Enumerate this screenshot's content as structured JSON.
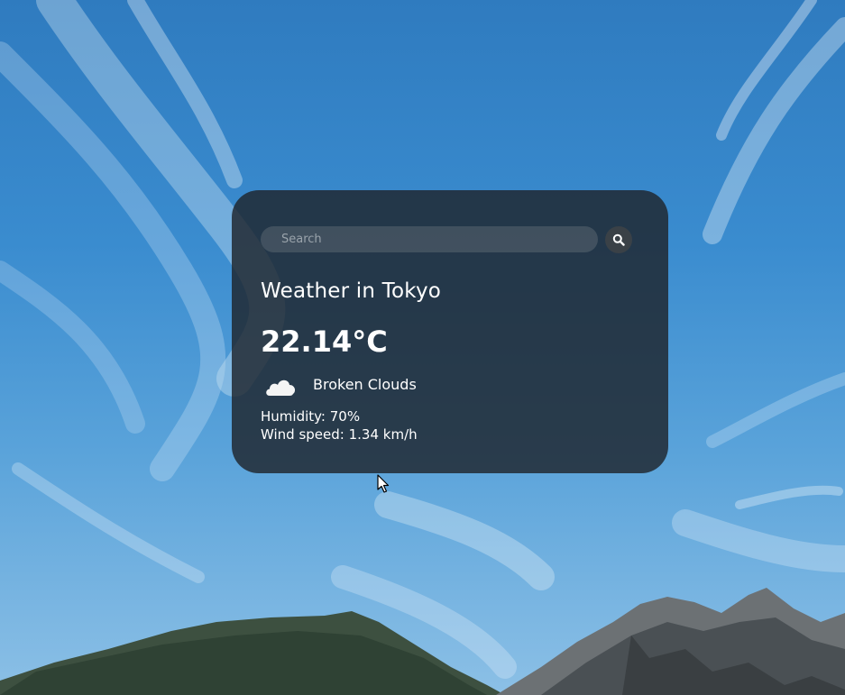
{
  "search": {
    "placeholder": "Search",
    "button_icon": "search-icon"
  },
  "weather": {
    "city_title": "Weather in Tokyo",
    "temperature": "22.14°C",
    "condition_icon": "cloud-icon",
    "description": "Broken Clouds",
    "humidity": "Humidity: 70%",
    "wind": "Wind speed: 1.34 km/h"
  },
  "colors": {
    "card_background": "#1e242c",
    "text": "#ffffff",
    "sky": "#3a8ccf"
  }
}
